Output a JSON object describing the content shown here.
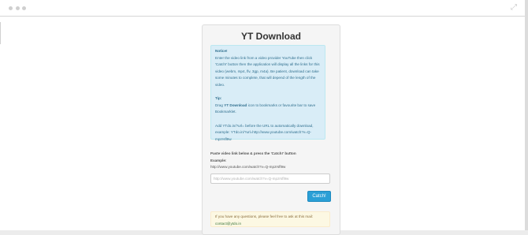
{
  "page": {
    "title": "YT Download"
  },
  "notice": {
    "heading": "Notice!",
    "body": "Enter the video link from a video provider YouTube then click 'Catch!' button then the application will display all the links for this video (webm, mp4, flv, 3gp, m4a). Be patient, download can take some minutes to complete, that will depend of the length of the video.",
    "tip_heading": "Tip:",
    "tip_prefix": "Drag",
    "tip_link": "YT Download",
    "tip_suffix": "icon to bookmarks or favourite bar to save Bookmarklet.",
    "extra": "Add YTdo.in/?url= before the URL to automatically download, example: YTdo.in/?url=http://www.youtube.com/watch?v=Q-mpzrsfl9w"
  },
  "form": {
    "instruction": "Paste video link below & press the 'Catch!' button",
    "example_label": "Example:",
    "example_url": "http://www.youtube.com/watch?v=Q-mpzrsfl9w",
    "input_placeholder": "http://www.youtube.com/watch?v=Q-mpzrsfl9w",
    "input_value": "",
    "button_label": "Catch!"
  },
  "help": {
    "text": "If you have any questions, please feel free to ask at this mail:",
    "email": "contact@ytdo.in"
  },
  "colors": {
    "accent": "#2a9fd6",
    "info_bg": "#d9edf7",
    "warning_bg": "#fcf8e3"
  }
}
